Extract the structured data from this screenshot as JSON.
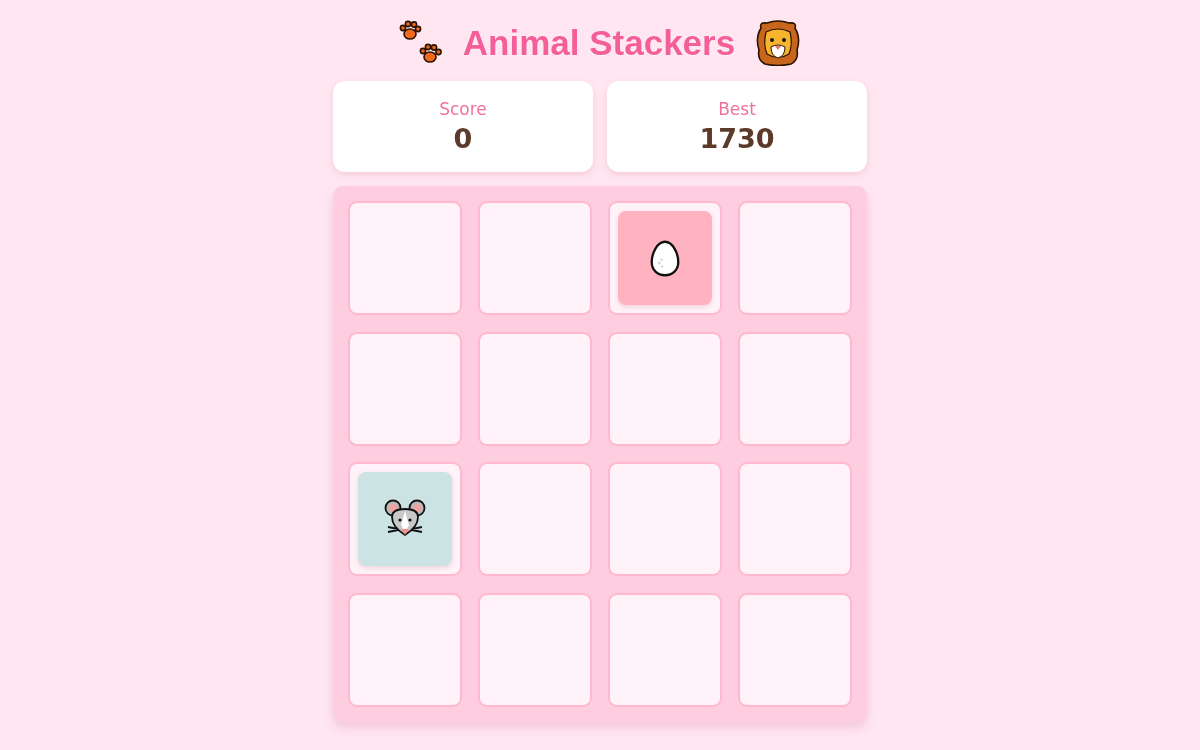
{
  "title": {
    "text": "Animal Stackers"
  },
  "scores": [
    {
      "label": "Score",
      "value": "0"
    },
    {
      "label": "Best",
      "value": "1730"
    }
  ],
  "board": {
    "rows": [
      [
        {
          "kind": "empty"
        },
        {
          "kind": "empty"
        },
        {
          "kind": "egg",
          "color": "#ffb3c1"
        },
        {
          "kind": "empty"
        }
      ],
      [
        {
          "kind": "empty"
        },
        {
          "kind": "empty"
        },
        {
          "kind": "empty"
        },
        {
          "kind": "empty"
        }
      ],
      [
        {
          "kind": "mouse",
          "color": "#cce3e3"
        },
        {
          "kind": "empty"
        },
        {
          "kind": "empty"
        },
        {
          "kind": "empty"
        }
      ],
      [
        {
          "kind": "empty"
        },
        {
          "kind": "empty"
        },
        {
          "kind": "empty"
        },
        {
          "kind": "empty"
        }
      ]
    ]
  }
}
